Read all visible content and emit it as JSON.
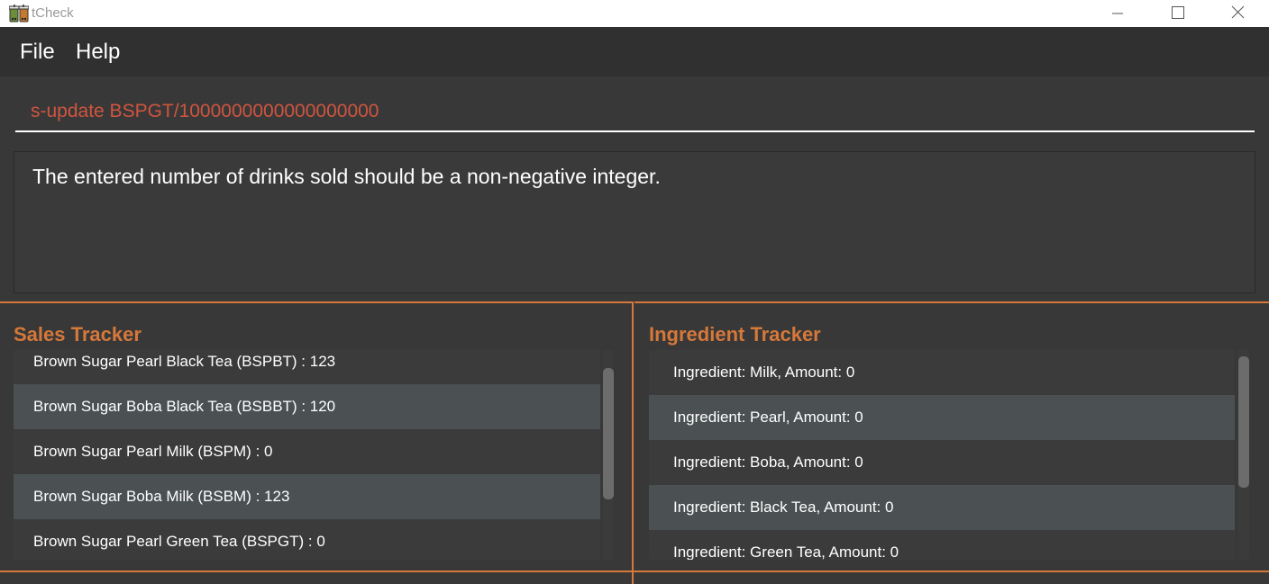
{
  "window": {
    "title": "tCheck",
    "app_icon": "bubble-tea-icon",
    "controls": [
      "minimize-icon",
      "maximize-icon",
      "close-icon"
    ]
  },
  "menu": {
    "file_label": "File",
    "help_label": "Help"
  },
  "command": {
    "value": "s-update BSPGT/1000000000000000000"
  },
  "result": {
    "message": "The entered number of drinks sold should be a non-negative integer."
  },
  "sales": {
    "title": "Sales Tracker",
    "items": [
      "Brown Sugar Pearl Black Tea (BSPBT) : 123",
      "Brown Sugar Boba Black Tea (BSBBT) : 120",
      "Brown Sugar Pearl Milk (BSPM) : 0",
      "Brown Sugar Boba Milk (BSBM) : 123",
      "Brown Sugar Pearl Green Tea (BSPGT) : 0"
    ]
  },
  "ingredients": {
    "title": "Ingredient Tracker",
    "items": [
      "Ingredient: Milk,  Amount: 0",
      "Ingredient: Pearl,  Amount: 0",
      "Ingredient: Boba,  Amount: 0",
      "Ingredient: Black Tea,  Amount: 0",
      "Ingredient: Green Tea,  Amount: 0"
    ]
  },
  "colors": {
    "accent": "#d6783a",
    "command_text": "#d0553f",
    "background": "#383838",
    "row_alt": "#4b5153"
  }
}
